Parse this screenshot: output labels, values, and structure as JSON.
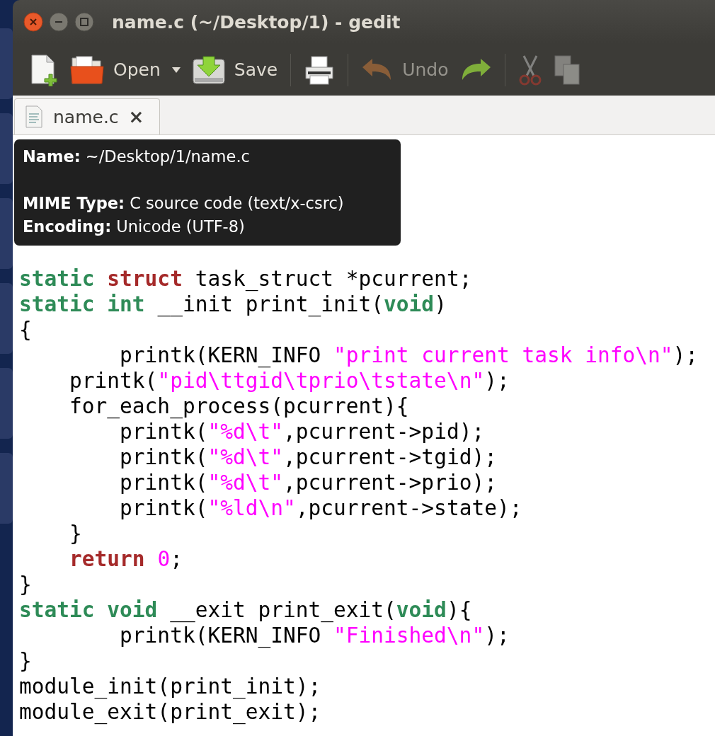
{
  "window": {
    "title": "name.c (~/Desktop/1) - gedit",
    "buttons": [
      {
        "kind": "close"
      },
      {
        "kind": "minimize"
      },
      {
        "kind": "maximize"
      }
    ]
  },
  "toolbar": {
    "items": [
      {
        "kind": "new",
        "disabled": false
      },
      {
        "kind": "open",
        "label": "Open",
        "disabled": false
      },
      {
        "kind": "dropdown",
        "disabled": false
      },
      {
        "kind": "save",
        "label": "Save",
        "disabled": false
      },
      {
        "kind": "separator"
      },
      {
        "kind": "print",
        "disabled": false
      },
      {
        "kind": "separator"
      },
      {
        "kind": "undo",
        "label": "Undo",
        "disabled": true
      },
      {
        "kind": "redo",
        "disabled": false
      },
      {
        "kind": "separator"
      },
      {
        "kind": "cut",
        "disabled": true
      },
      {
        "kind": "copy",
        "disabled": true
      }
    ]
  },
  "tabs": [
    {
      "label": "name.c",
      "close": "×",
      "selected": true
    }
  ],
  "tooltip": {
    "sections": [
      [
        "**Name:** ~/Desktop/1/name.c"
      ],
      [
        "**MIME Type:** C source code (text/x-csrc)",
        "**Encoding:** Unicode (UTF-8)"
      ]
    ]
  },
  "editor": {
    "lines": [
      [
        {
          "kind": "keyword",
          "text": "static "
        },
        {
          "kind": "type",
          "text": "struct"
        },
        {
          "kind": "plain",
          "text": " task_struct *pcurrent;"
        }
      ],
      [
        {
          "kind": "keyword",
          "text": "static "
        },
        {
          "kind": "keyword",
          "text": "int"
        },
        {
          "kind": "plain",
          "text": " __init print_init("
        },
        {
          "kind": "keyword",
          "text": "void"
        },
        {
          "kind": "plain",
          "text": ")"
        }
      ],
      [
        {
          "kind": "plain",
          "text": "{"
        }
      ],
      [
        {
          "kind": "plain",
          "text": "        printk(KERN_INFO "
        },
        {
          "kind": "string",
          "text": "\"print current task info\\n\""
        },
        {
          "kind": "plain",
          "text": ");"
        }
      ],
      [
        {
          "kind": "plain",
          "text": "    printk("
        },
        {
          "kind": "string",
          "text": "\"pid\\ttgid\\tprio\\tstate\\n\""
        },
        {
          "kind": "plain",
          "text": ");"
        }
      ],
      [
        {
          "kind": "plain",
          "text": "    for_each_process(pcurrent){"
        }
      ],
      [
        {
          "kind": "plain",
          "text": "        printk("
        },
        {
          "kind": "string",
          "text": "\"%d\\t\""
        },
        {
          "kind": "plain",
          "text": ",pcurrent->pid);"
        }
      ],
      [
        {
          "kind": "plain",
          "text": "        printk("
        },
        {
          "kind": "string",
          "text": "\"%d\\t\""
        },
        {
          "kind": "plain",
          "text": ",pcurrent->tgid);"
        }
      ],
      [
        {
          "kind": "plain",
          "text": "        printk("
        },
        {
          "kind": "string",
          "text": "\"%d\\t\""
        },
        {
          "kind": "plain",
          "text": ",pcurrent->prio);"
        }
      ],
      [
        {
          "kind": "plain",
          "text": "        printk("
        },
        {
          "kind": "string",
          "text": "\"%ld\\n\""
        },
        {
          "kind": "plain",
          "text": ",pcurrent->state);"
        }
      ],
      [
        {
          "kind": "plain",
          "text": "    }"
        }
      ],
      [
        {
          "kind": "type",
          "text": "    return "
        },
        {
          "kind": "number",
          "text": "0"
        },
        {
          "kind": "plain",
          "text": ";"
        }
      ],
      [
        {
          "kind": "plain",
          "text": "}"
        }
      ],
      [
        {
          "kind": "keyword",
          "text": "static "
        },
        {
          "kind": "keyword",
          "text": "void"
        },
        {
          "kind": "plain",
          "text": " __exit print_exit("
        },
        {
          "kind": "keyword",
          "text": "void"
        },
        {
          "kind": "plain",
          "text": "){"
        }
      ],
      [
        {
          "kind": "plain",
          "text": "        printk(KERN_INFO "
        },
        {
          "kind": "string",
          "text": "\"Finished\\n\""
        },
        {
          "kind": "plain",
          "text": ");"
        }
      ],
      [
        {
          "kind": "plain",
          "text": "}"
        }
      ],
      [
        {
          "kind": "plain",
          "text": "module_init(print_init);"
        }
      ],
      [
        {
          "kind": "plain",
          "text": "module_exit(print_exit);"
        }
      ]
    ]
  }
}
